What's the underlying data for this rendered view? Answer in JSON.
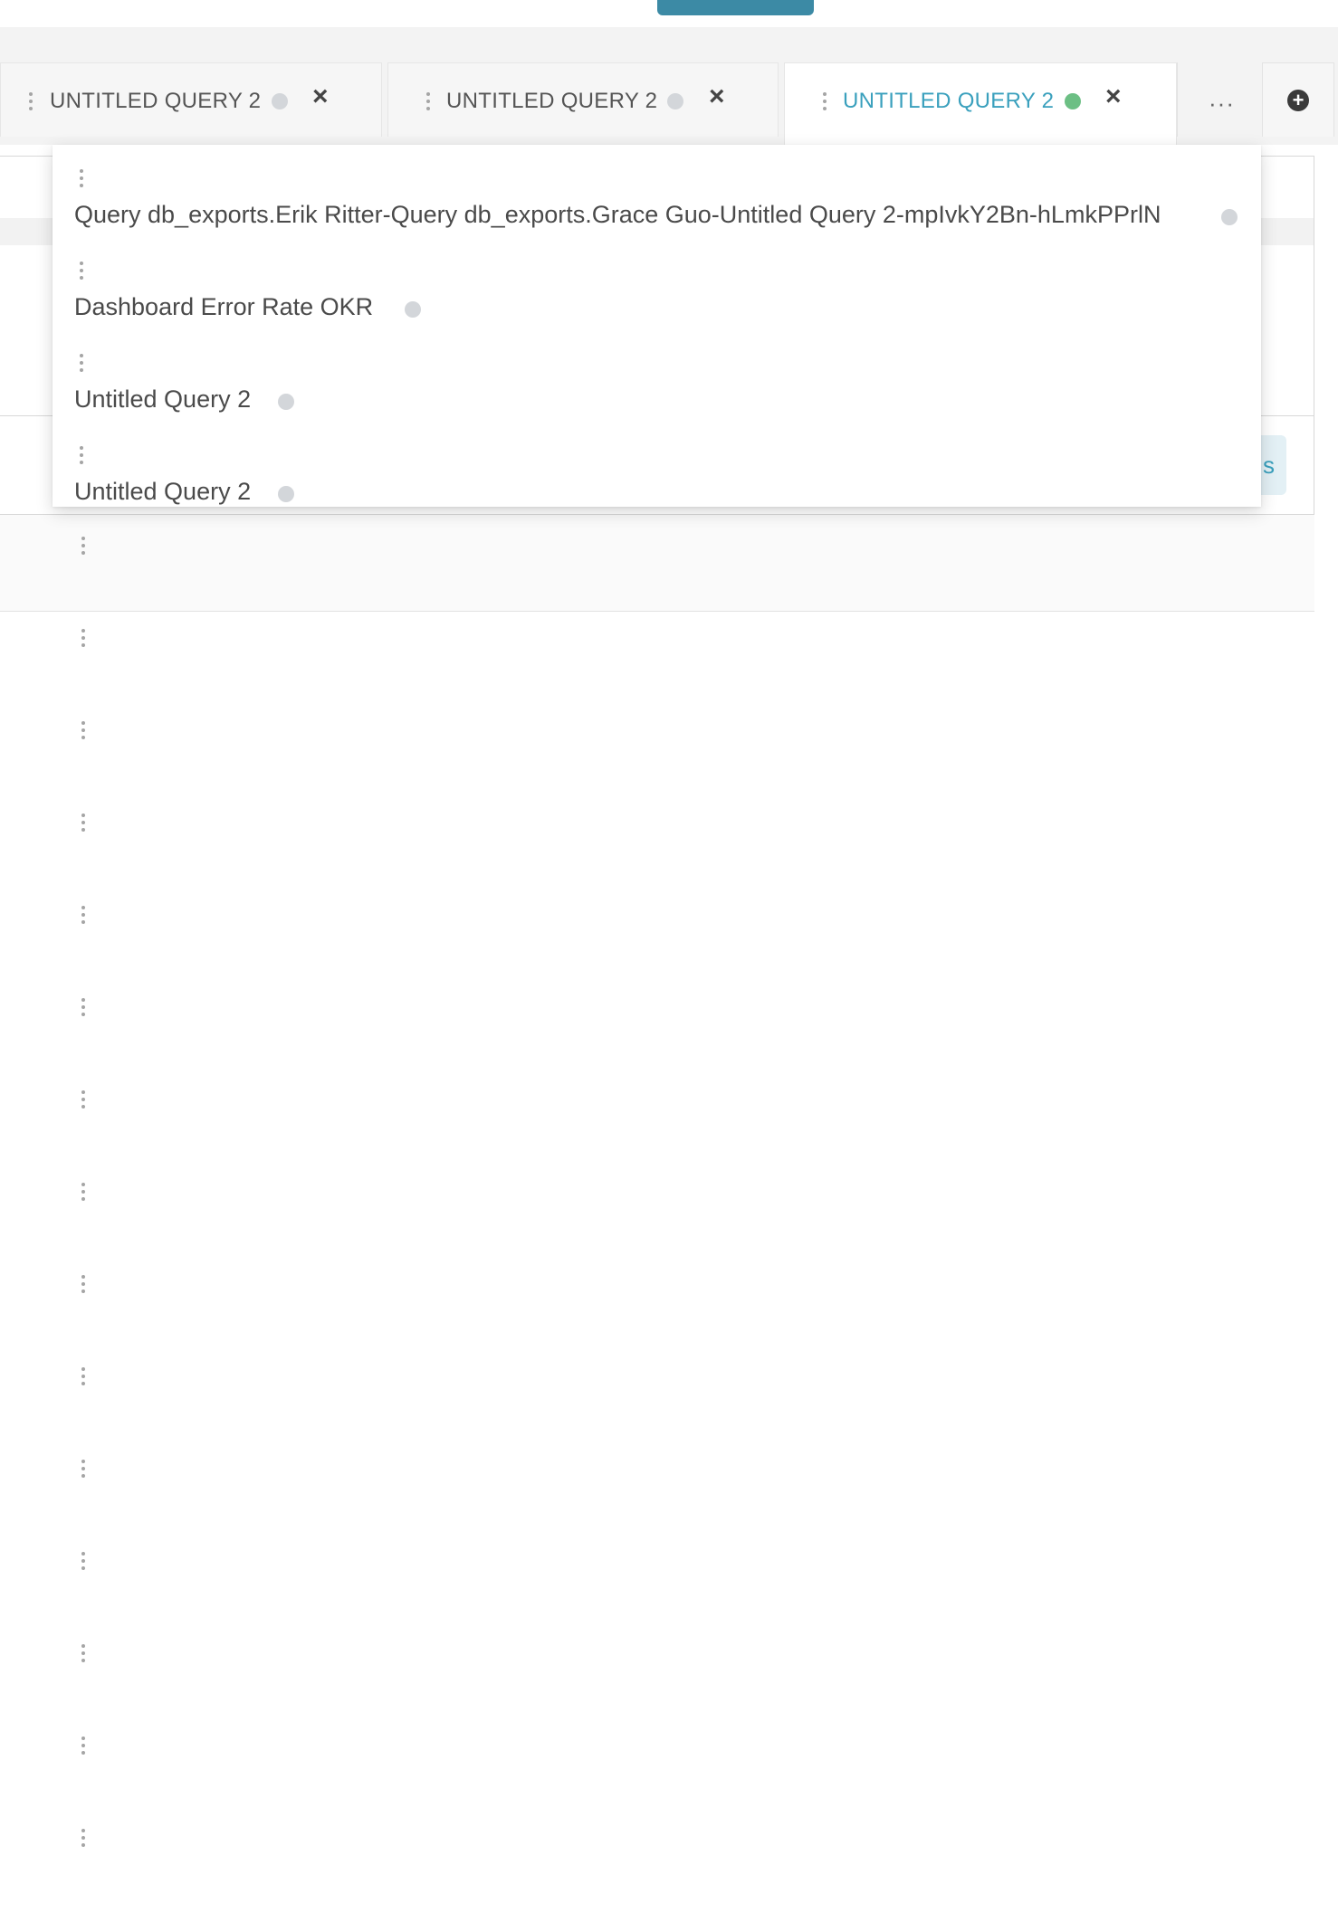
{
  "tabs": [
    {
      "label": "UNTITLED QUERY 2",
      "status_color": "#d3d6da",
      "active": false,
      "close_icon": "close-icon"
    },
    {
      "label": "UNTITLED QUERY 2",
      "status_color": "#d3d6da",
      "active": false,
      "close_icon": "close-icon"
    },
    {
      "label": "UNTITLED QUERY 2",
      "status_color": "#6cbf84",
      "active": true,
      "close_icon": "close-icon"
    }
  ],
  "overflow_menu": {
    "label": "···"
  },
  "add_tab": {
    "icon": "plus-circle-icon",
    "label": "+"
  },
  "editor": {
    "button_fragment": "s"
  },
  "dropdown": {
    "items": [
      {
        "label": "Query db_exports.Erik Ritter-Query db_exports.Grace Guo-Untitled Query 2-mpIvkY2Bn-hLmkPPrlN",
        "status_color": "#d3d6da"
      },
      {
        "label": "Dashboard Error Rate OKR",
        "status_color": "#d3d6da"
      },
      {
        "label": "Untitled Query 2",
        "status_color": "#d3d6da"
      },
      {
        "label": "Untitled Query 2",
        "status_color": "#d3d6da"
      }
    ]
  },
  "colors": {
    "accent": "#3aa0bd",
    "run_button": "#3c8aa5",
    "status_active": "#6cbf84",
    "status_idle": "#d3d6da"
  }
}
